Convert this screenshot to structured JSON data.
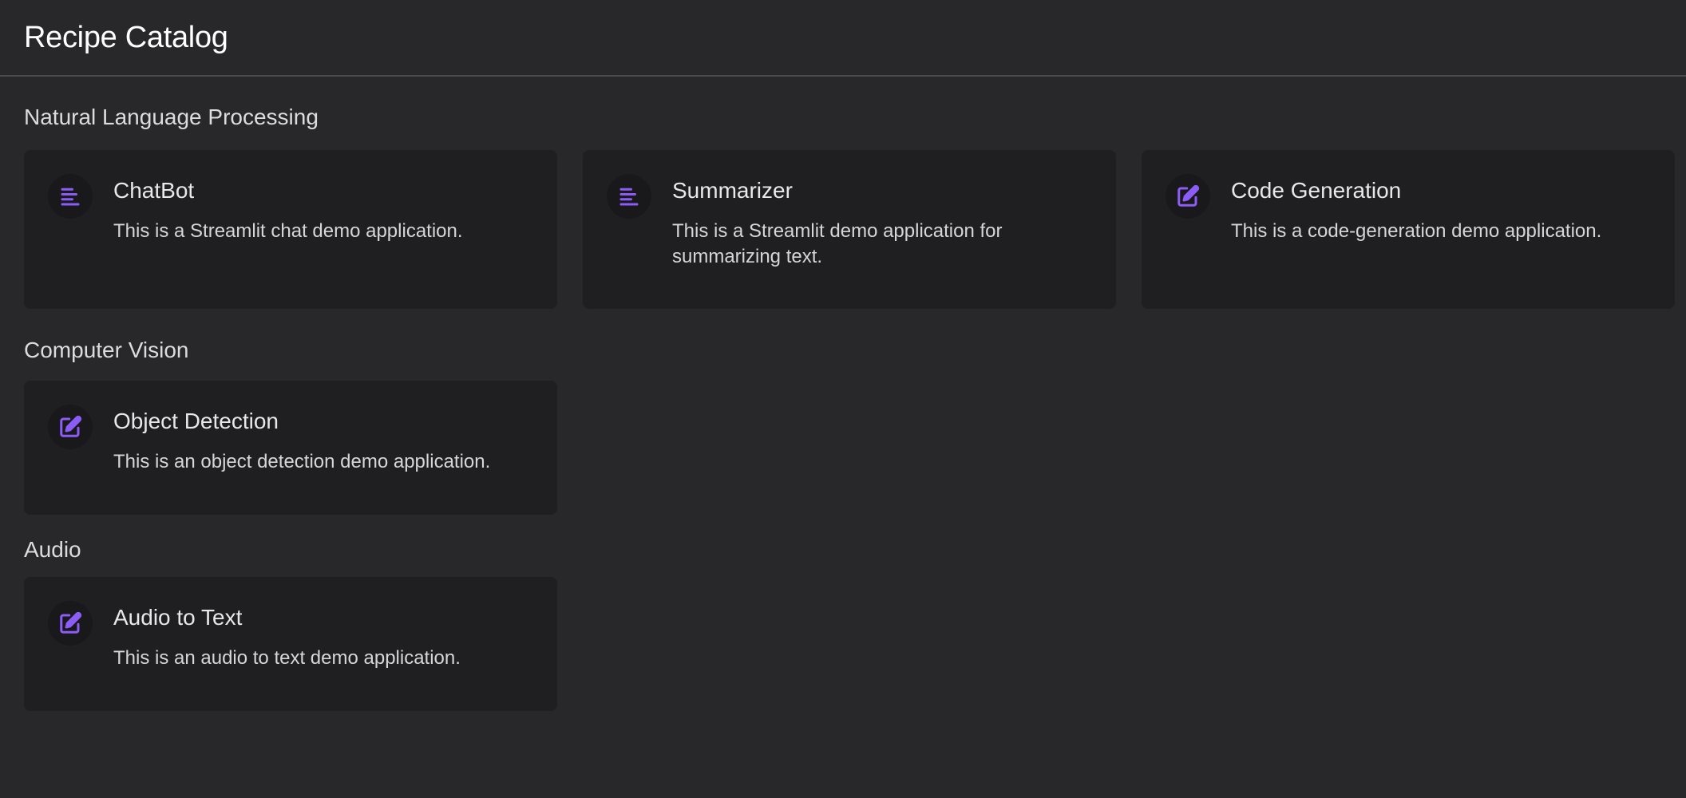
{
  "header": {
    "title": "Recipe Catalog"
  },
  "accent_color": "#8b5cf6",
  "sections": [
    {
      "title": "Natural Language Processing",
      "cards": [
        {
          "icon": "align-left-icon",
          "title": "ChatBot",
          "description": "This is a Streamlit chat demo application."
        },
        {
          "icon": "align-left-icon",
          "title": "Summarizer",
          "description": "This is a Streamlit demo application for summarizing text."
        },
        {
          "icon": "edit-icon",
          "title": "Code Generation",
          "description": "This is a code-generation demo application."
        }
      ]
    },
    {
      "title": "Computer Vision",
      "cards": [
        {
          "icon": "edit-icon",
          "title": "Object Detection",
          "description": "This is an object detection demo application."
        }
      ]
    },
    {
      "title": "Audio",
      "cards": [
        {
          "icon": "edit-icon",
          "title": "Audio to Text",
          "description": "This is an audio to text demo application."
        }
      ]
    }
  ]
}
